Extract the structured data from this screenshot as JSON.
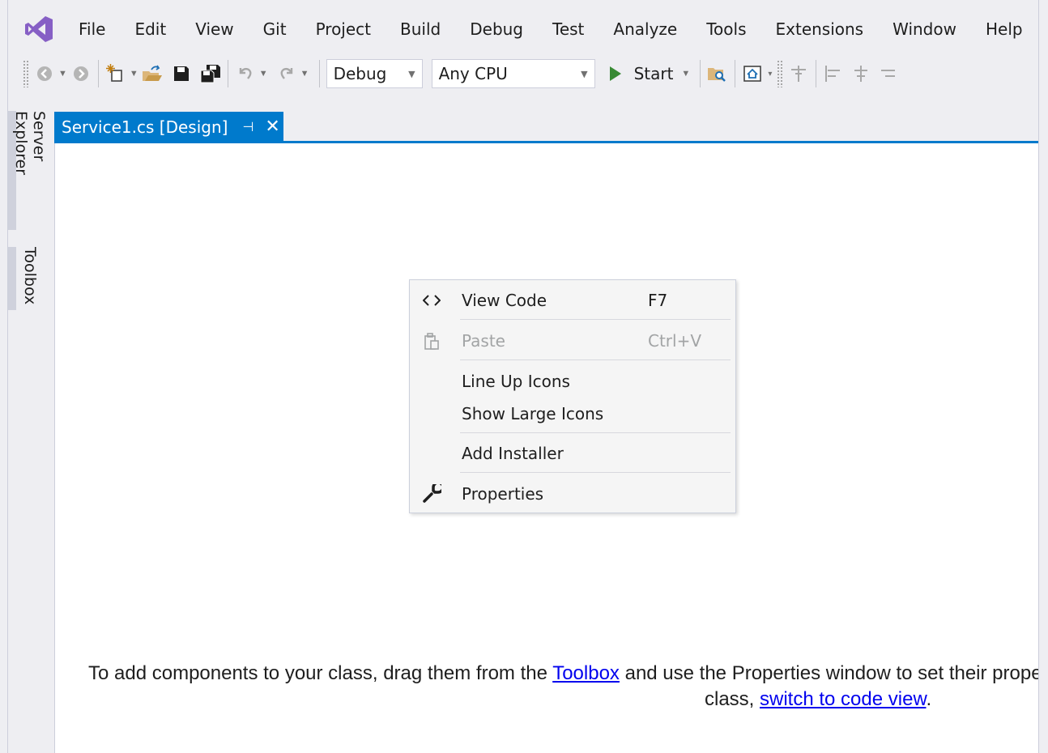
{
  "menu": [
    "File",
    "Edit",
    "View",
    "Git",
    "Project",
    "Build",
    "Debug",
    "Test",
    "Analyze",
    "Tools",
    "Extensions",
    "Window",
    "Help"
  ],
  "toolbar": {
    "config": "Debug",
    "platform": "Any CPU",
    "start_label": "Start"
  },
  "side_tabs": {
    "server_explorer": "Server Explorer",
    "toolbox": "Toolbox"
  },
  "doc_tab": {
    "title": "Service1.cs [Design]",
    "pin": "⊣",
    "close": "✕"
  },
  "context_menu": {
    "view_code": {
      "label": "View Code",
      "shortcut": "F7",
      "icon": "code-brackets-icon"
    },
    "paste": {
      "label": "Paste",
      "shortcut": "Ctrl+V",
      "icon": "clipboard-icon"
    },
    "line_up": {
      "label": "Line Up Icons"
    },
    "show_large": {
      "label": "Show Large Icons"
    },
    "add_installer": {
      "label": "Add Installer"
    },
    "properties": {
      "label": "Properties",
      "icon": "wrench-icon"
    }
  },
  "hint": {
    "part1": "To add components to your class, drag them from the ",
    "toolbox_link": "Toolbox",
    "part2": " and use the Properties window to set their properties. To create methods and events for your",
    "part3": "class, ",
    "code_link": "switch to code view",
    "part4": "."
  },
  "colors": {
    "accent": "#007acc",
    "start_green": "#388a34",
    "vs_purple": "#865fc5"
  }
}
